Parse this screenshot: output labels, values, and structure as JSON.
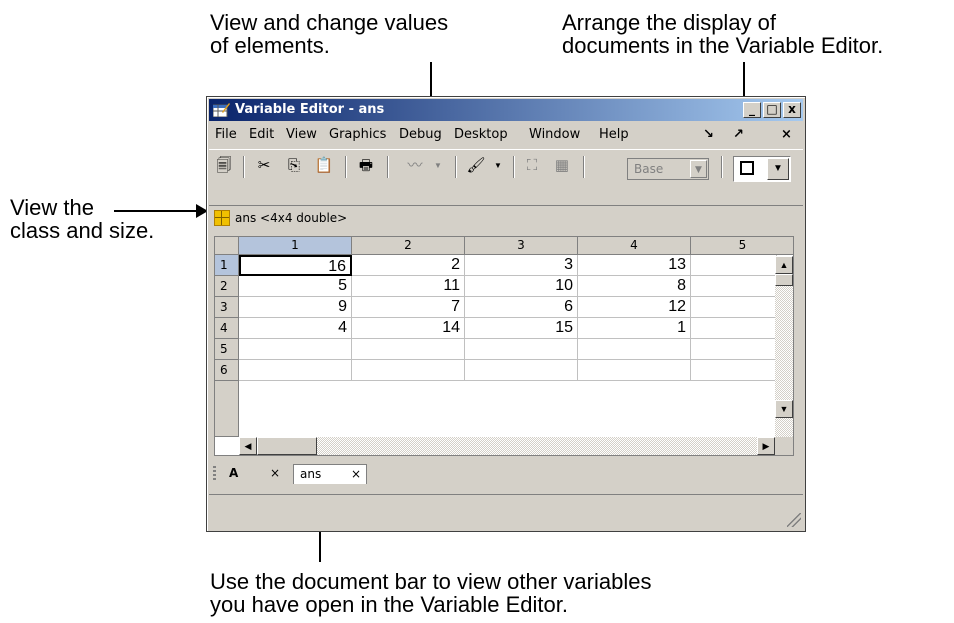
{
  "annotations": {
    "top_middle": [
      "View and change values",
      "of elements."
    ],
    "top_right": [
      "Arrange the display of",
      "documents in the Variable Editor."
    ],
    "left": [
      "View the",
      "class and size."
    ],
    "bottom": [
      "Use the document bar to view other variables",
      "you have open in the Variable Editor."
    ]
  },
  "window": {
    "title": "Variable Editor - ans",
    "controls": {
      "minimize": "_",
      "maximize": "□",
      "close": "x"
    }
  },
  "menu": [
    "File",
    "Edit",
    "View",
    "Graphics",
    "Debug",
    "Desktop",
    "Window",
    "Help"
  ],
  "menu_dock": {
    "undock": "↘",
    "maximize": "↗",
    "close": "×"
  },
  "toolbar": {
    "icons": [
      "import-data-icon",
      "cut-icon",
      "copy-icon",
      "paste-icon",
      "print-icon",
      "plot-icon",
      "brush-icon",
      "link-icon"
    ],
    "base_label": "Base",
    "arrange_label": "□"
  },
  "variable_info": "ans <4x4 double>",
  "grid": {
    "columns": [
      "1",
      "2",
      "3",
      "4",
      "5"
    ],
    "rows": [
      "1",
      "2",
      "3",
      "4",
      "5",
      "6"
    ],
    "values": [
      [
        "16",
        "2",
        "3",
        "13",
        ""
      ],
      [
        "5",
        "11",
        "10",
        "8",
        ""
      ],
      [
        "9",
        "7",
        "6",
        "12",
        ""
      ],
      [
        "4",
        "14",
        "15",
        "1",
        ""
      ],
      [
        "",
        "",
        "",
        "",
        ""
      ],
      [
        "",
        "",
        "",
        "",
        ""
      ]
    ],
    "active_cell": {
      "row": 0,
      "col": 0
    }
  },
  "document_tabs": [
    {
      "name": "A",
      "close": "×"
    },
    {
      "name": "ans",
      "close": "×"
    }
  ],
  "colors": {
    "title_start": "#0a246a",
    "title_end": "#a6caf0",
    "chrome": "#d4d0c8",
    "selected_header": "#b4c4dc"
  }
}
